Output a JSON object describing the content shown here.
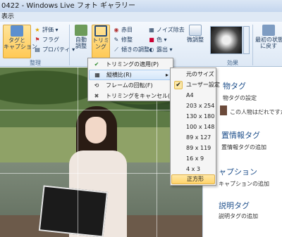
{
  "window": {
    "title": "0422 - Windows Live フォト ギャラリー"
  },
  "menubar": {
    "view": "表示"
  },
  "ribbon": {
    "tag_caption": "タグと\nキャプション",
    "rating": "評価",
    "flag": "フラグ",
    "properties": "プロパティ",
    "group_organize": "整理",
    "auto_adjust": "自動\n調整",
    "crop": "トリミ\nング",
    "red_eye": "赤目",
    "retouch": "修整",
    "straighten": "傾きの調整",
    "noise": "ノイズ除去",
    "color": "色",
    "exposure": "露出",
    "fine_tune": "微調整",
    "group_effects": "効果",
    "revert": "最初の状態\nに戻す"
  },
  "crop_menu": {
    "items": [
      {
        "label": "トリミングの適用(P)",
        "icon": "✔"
      },
      {
        "label": "縦横比(R)",
        "icon": "▦",
        "submenu": true
      },
      {
        "label": "フレームの回転(F)",
        "icon": "⟲"
      },
      {
        "label": "トリミングをキャンセル(C)",
        "icon": "✖"
      }
    ]
  },
  "aspect_menu": {
    "items": [
      {
        "label": "元のサイズ"
      },
      {
        "label": "ユーザー設定",
        "checked": true
      },
      {
        "label": "A4"
      },
      {
        "label": "203 x 254"
      },
      {
        "label": "130 x 180"
      },
      {
        "label": "100 x 148"
      },
      {
        "label": "89 x 127"
      },
      {
        "label": "89 x 119"
      },
      {
        "label": "16 x 9"
      },
      {
        "label": "4 x 3"
      },
      {
        "label": "正方形",
        "highlighted": true
      }
    ]
  },
  "right_pane": {
    "people_tag_tail": "物タグ",
    "people_tag_add": "物タグの設定",
    "person_unknown": "この人物はだれですか?",
    "geotag_head": "置情報タグ",
    "geotag_add": "置情報タグの追加",
    "caption_head": "ャプション",
    "caption_add": "キャプションの追加",
    "desc_head": "説明タグ",
    "desc_add": "説明タグの追加"
  },
  "colors": {
    "accent": "#ffc955",
    "menu_highlight": "#d5e7fa"
  }
}
